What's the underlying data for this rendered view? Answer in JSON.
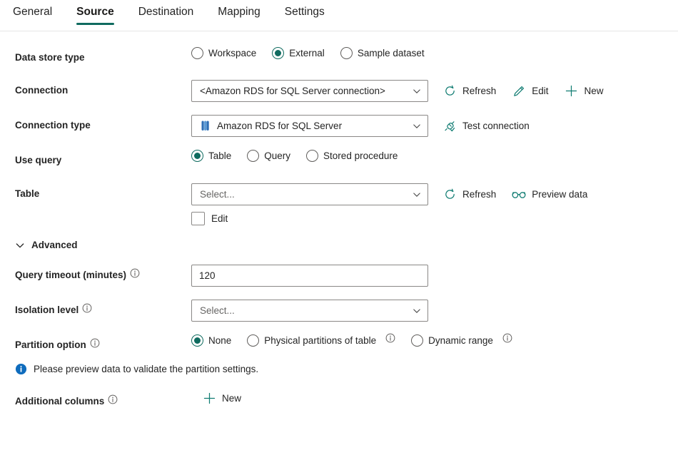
{
  "tabs": [
    {
      "label": "General",
      "active": false
    },
    {
      "label": "Source",
      "active": true
    },
    {
      "label": "Destination",
      "active": false
    },
    {
      "label": "Mapping",
      "active": false
    },
    {
      "label": "Settings",
      "active": false
    }
  ],
  "colors": {
    "accent_teal": "#0f6b5f",
    "icon_teal": "#107c72",
    "info_blue": "#0f6cbd",
    "border_gray": "#8a8886",
    "text": "#242424"
  },
  "fields": {
    "data_store_type": {
      "label": "Data store type",
      "options": [
        {
          "label": "Workspace",
          "checked": false
        },
        {
          "label": "External",
          "checked": true
        },
        {
          "label": "Sample dataset",
          "checked": false
        }
      ]
    },
    "connection": {
      "label": "Connection",
      "value": "<Amazon RDS for SQL Server connection>",
      "commands": [
        {
          "label": "Refresh",
          "icon": "refresh-icon"
        },
        {
          "label": "Edit",
          "icon": "pencil-icon"
        },
        {
          "label": "New",
          "icon": "plus-icon"
        }
      ]
    },
    "connection_type": {
      "label": "Connection type",
      "value": "Amazon RDS for SQL Server",
      "lead_icon": "database-icon",
      "commands": [
        {
          "label": "Test connection",
          "icon": "plug-check-icon"
        }
      ]
    },
    "use_query": {
      "label": "Use query",
      "options": [
        {
          "label": "Table",
          "checked": true
        },
        {
          "label": "Query",
          "checked": false
        },
        {
          "label": "Stored procedure",
          "checked": false
        }
      ]
    },
    "table": {
      "label": "Table",
      "placeholder": "Select...",
      "value": "",
      "commands": [
        {
          "label": "Refresh",
          "icon": "refresh-icon"
        },
        {
          "label": "Preview data",
          "icon": "glasses-icon"
        }
      ],
      "edit_checkbox": {
        "label": "Edit",
        "checked": false
      }
    },
    "advanced": {
      "label": "Advanced",
      "expanded": true
    },
    "query_timeout": {
      "label": "Query timeout (minutes)",
      "value": "120",
      "has_info": true
    },
    "isolation_level": {
      "label": "Isolation level",
      "placeholder": "Select...",
      "value": "",
      "has_info": true
    },
    "partition_option": {
      "label": "Partition option",
      "has_info": true,
      "options": [
        {
          "label": "None",
          "checked": true,
          "has_info": false
        },
        {
          "label": "Physical partitions of table",
          "checked": false,
          "has_info": true
        },
        {
          "label": "Dynamic range",
          "checked": false,
          "has_info": true
        }
      ]
    },
    "partition_message": {
      "icon": "info-filled-icon",
      "text": "Please preview data to validate the partition settings."
    },
    "additional_columns": {
      "label": "Additional columns",
      "has_info": true,
      "commands": [
        {
          "label": "New",
          "icon": "plus-icon"
        }
      ]
    }
  }
}
